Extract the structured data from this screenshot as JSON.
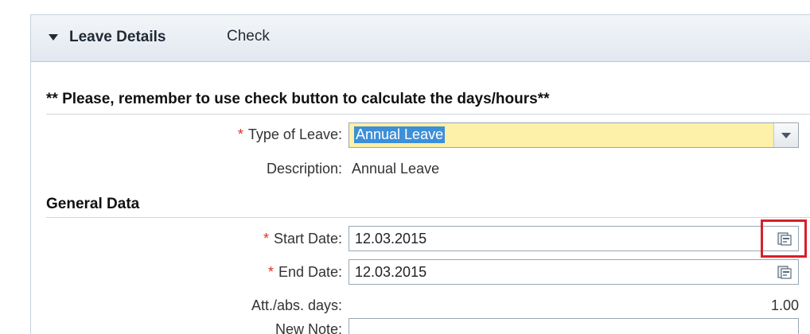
{
  "panel": {
    "title": "Leave Details",
    "check_label": "Check"
  },
  "notice": "** Please, remember to use check button to calculate the days/hours**",
  "fields": {
    "type_of_leave": {
      "required_mark": "*",
      "label": "Type of Leave:",
      "value": "Annual Leave"
    },
    "description": {
      "label": "Description:",
      "value": "Annual Leave"
    },
    "general_data_title": "General Data",
    "start_date": {
      "required_mark": "*",
      "label": "Start Date:",
      "value": "12.03.2015"
    },
    "end_date": {
      "required_mark": "*",
      "label": "End Date:",
      "value": "12.03.2015"
    },
    "att_abs_days": {
      "label": "Att./abs. days:",
      "value": "1.00"
    },
    "new_note": {
      "label": "New Note:",
      "value": ""
    }
  },
  "colors": {
    "required": "#e0301e",
    "highlight": "#d6202a",
    "select_background": "#fdf0a8",
    "selection": "#3d8fd8"
  },
  "icons": {
    "expand": "triangle-down-icon",
    "dropdown": "chevron-down-icon",
    "calendar": "calendar-icon"
  }
}
